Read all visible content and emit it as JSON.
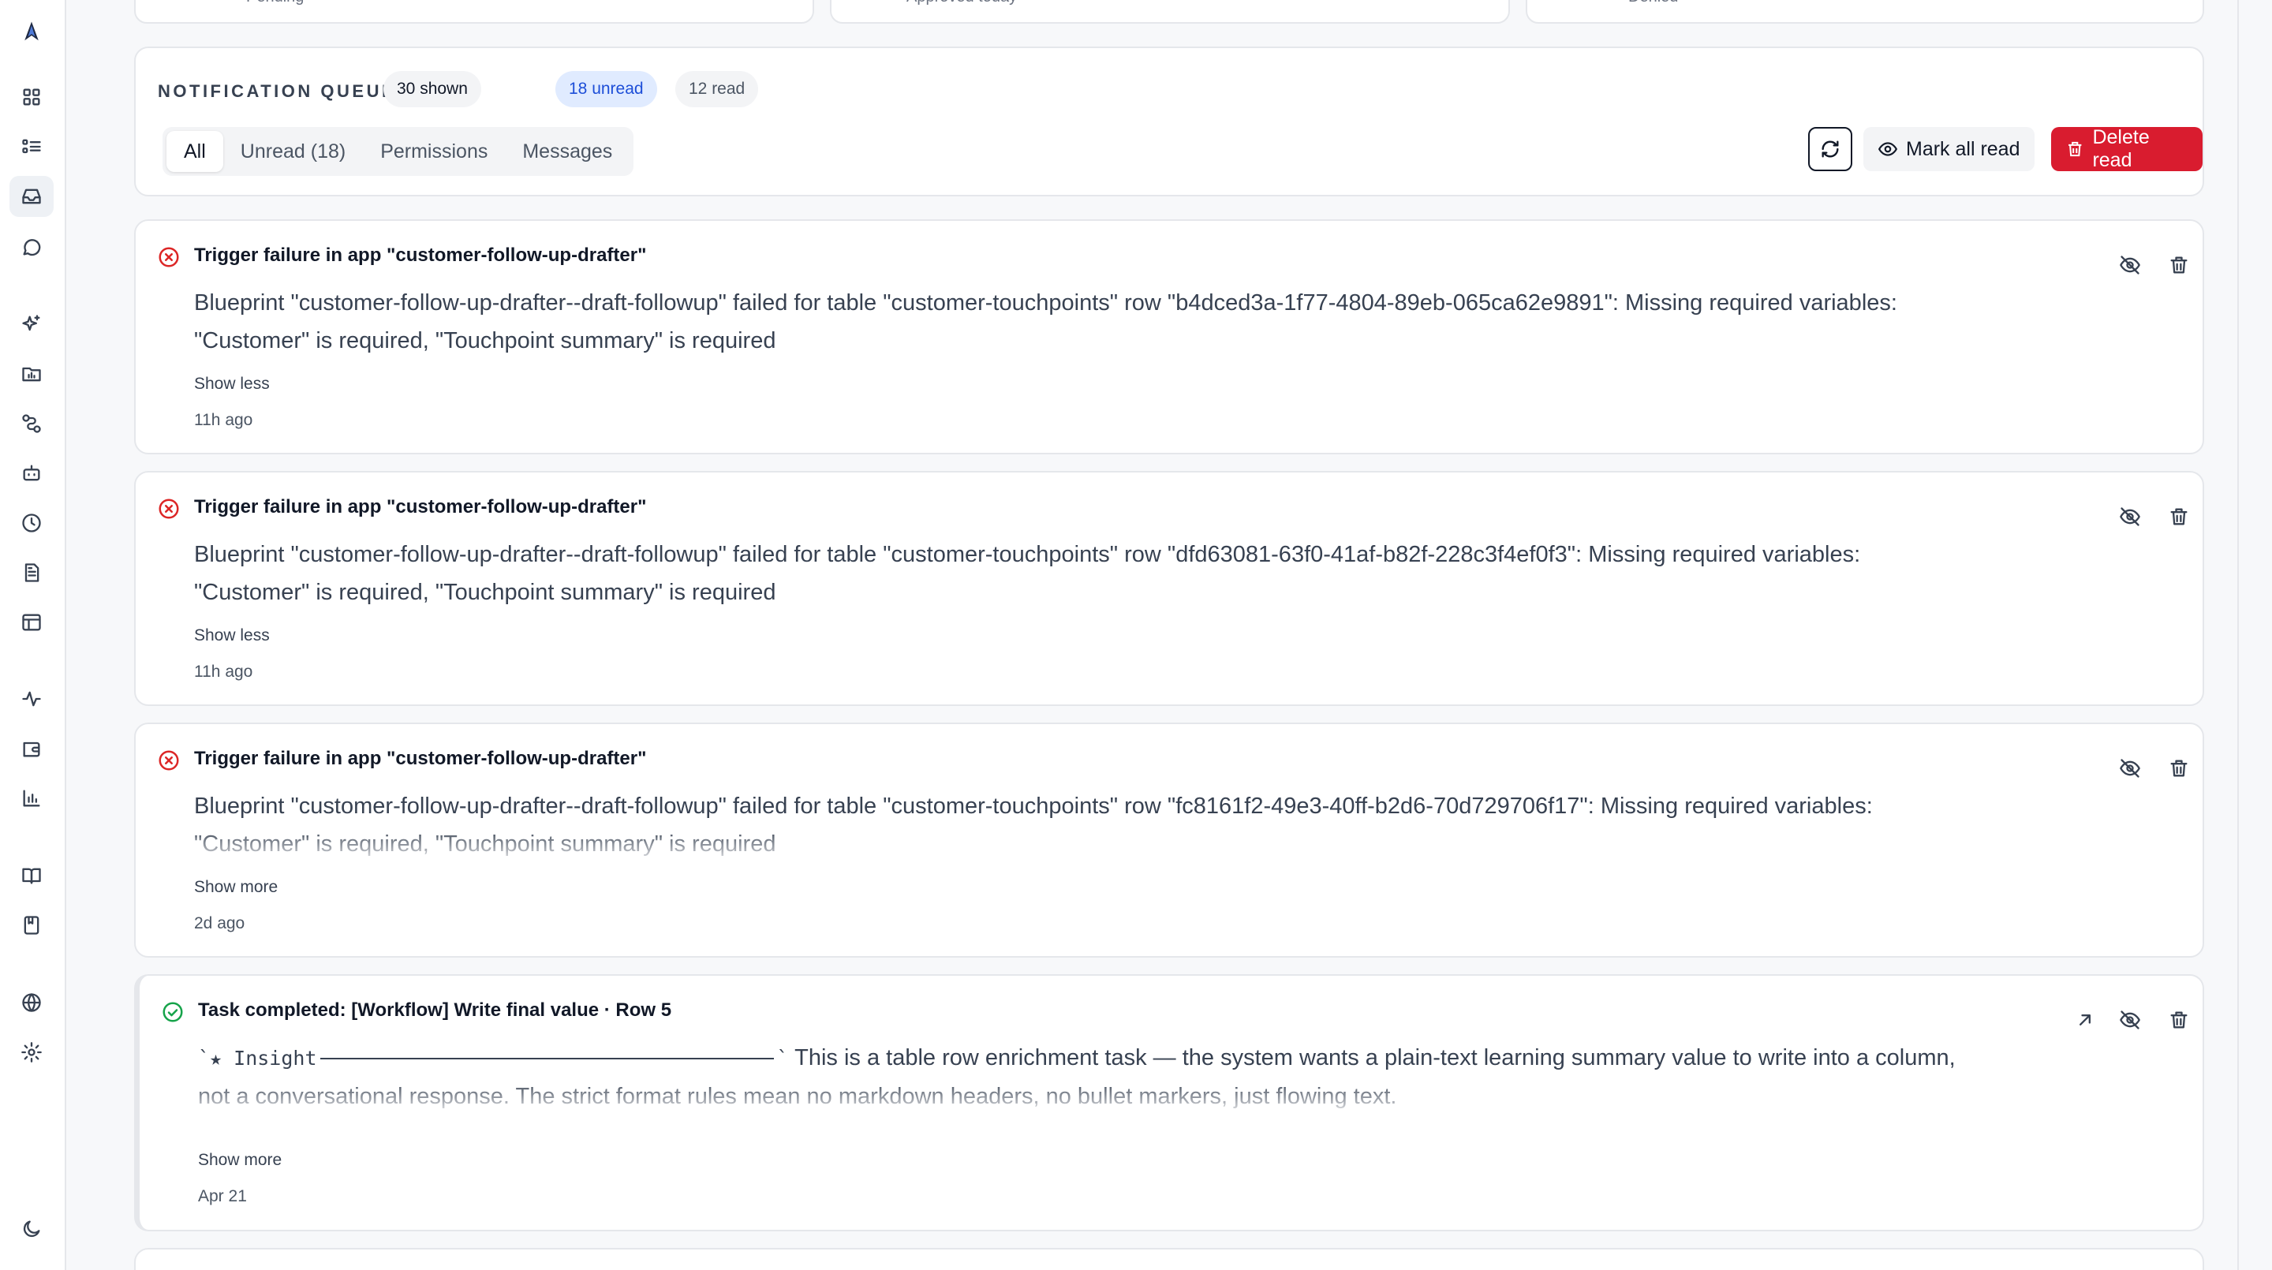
{
  "stats": [
    {
      "label": "Pending"
    },
    {
      "label": "Approved today"
    },
    {
      "label": "Denied"
    }
  ],
  "queue": {
    "title": "NOTIFICATION QUEUE",
    "shown": "30 shown",
    "unread": "18 unread",
    "read": "12 read"
  },
  "tabs": [
    {
      "label": "All",
      "active": true
    },
    {
      "label": "Unread (18)",
      "active": false
    },
    {
      "label": "Permissions",
      "active": false
    },
    {
      "label": "Messages",
      "active": false
    }
  ],
  "toolbar": {
    "mark_all_read": "Mark all read",
    "delete_read": "Delete read"
  },
  "notifications": [
    {
      "status": "error",
      "title": "Trigger failure in app \"customer-follow-up-drafter\"",
      "line1": "Blueprint \"customer-follow-up-drafter--draft-followup\" failed for table \"customer-touchpoints\" row \"b4dced3a-1f77-4804-89eb-065ca62e9891\": Missing required variables:",
      "line2": "\"Customer\" is required, \"Touchpoint summary\" is required",
      "toggle": "Show less",
      "time": "11h ago"
    },
    {
      "status": "error",
      "title": "Trigger failure in app \"customer-follow-up-drafter\"",
      "line1": "Blueprint \"customer-follow-up-drafter--draft-followup\" failed for table \"customer-touchpoints\" row \"dfd63081-63f0-41af-b82f-228c3f4ef0f3\": Missing required variables:",
      "line2": "\"Customer\" is required, \"Touchpoint summary\" is required",
      "toggle": "Show less",
      "time": "11h ago"
    },
    {
      "status": "error",
      "title": "Trigger failure in app \"customer-follow-up-drafter\"",
      "line1": "Blueprint \"customer-follow-up-drafter--draft-followup\" failed for table \"customer-touchpoints\" row \"fc8161f2-49e3-40ff-b2d6-70d729706f17\": Missing required variables:",
      "line2": "\"Customer\" is required, \"Touchpoint summary\" is required",
      "toggle": "Show more",
      "time": "2d ago"
    },
    {
      "status": "success",
      "title": "Task completed: [Workflow] Write final value · Row 5",
      "code_prefix": "`★ Insight",
      "code_suffix": "`",
      "line1_rest": "This is a table row enrichment task — the system wants a plain-text learning summary value to write into a column,",
      "line2": "not a conversational response. The strict format rules mean no markdown headers, no bullet markers, just flowing text.",
      "toggle": "Show more",
      "time": "Apr 21"
    }
  ],
  "colors": {
    "error": "#dc2626",
    "success": "#16a34a",
    "danger_button": "#d91c2f",
    "unread_pill_bg": "#e0ebff",
    "unread_pill_text": "#1d4ed8"
  }
}
